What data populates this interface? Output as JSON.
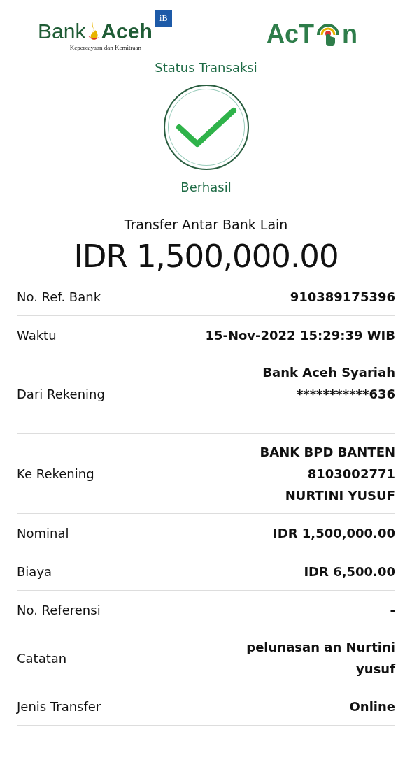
{
  "header": {
    "bank_logo": {
      "name_left": "Bank",
      "name_right": "Aceh",
      "badge": "iB",
      "tagline": "Kepercayaan dan Kemitraan"
    },
    "app_logo": {
      "left": "AcT",
      "right": "n"
    }
  },
  "status": {
    "title": "Status Transaksi",
    "result": "Berhasil",
    "success": true
  },
  "transaction": {
    "type": "Transfer Antar Bank Lain",
    "amount": "IDR 1,500,000.00"
  },
  "details": [
    {
      "label": "No. Ref. Bank",
      "lines": [
        "910389175396"
      ]
    },
    {
      "label": "Waktu",
      "lines": [
        "15-Nov-2022 15:29:39 WIB"
      ]
    },
    {
      "label": "Dari Rekening",
      "lines": [
        "Bank Aceh Syariah",
        "***********636"
      ],
      "blank_line": true
    },
    {
      "label": "Ke Rekening",
      "lines": [
        "BANK BPD BANTEN",
        "8103002771",
        "NURTINI YUSUF"
      ]
    },
    {
      "label": "Nominal",
      "lines": [
        "IDR 1,500,000.00"
      ]
    },
    {
      "label": "Biaya",
      "lines": [
        "IDR 6,500.00"
      ]
    },
    {
      "label": "No. Referensi",
      "lines": [
        "-"
      ]
    },
    {
      "label": "Catatan",
      "lines": [
        "pelunasan an Nurtini",
        "yusuf"
      ]
    },
    {
      "label": "Jenis Transfer",
      "lines": [
        "Online"
      ]
    }
  ]
}
